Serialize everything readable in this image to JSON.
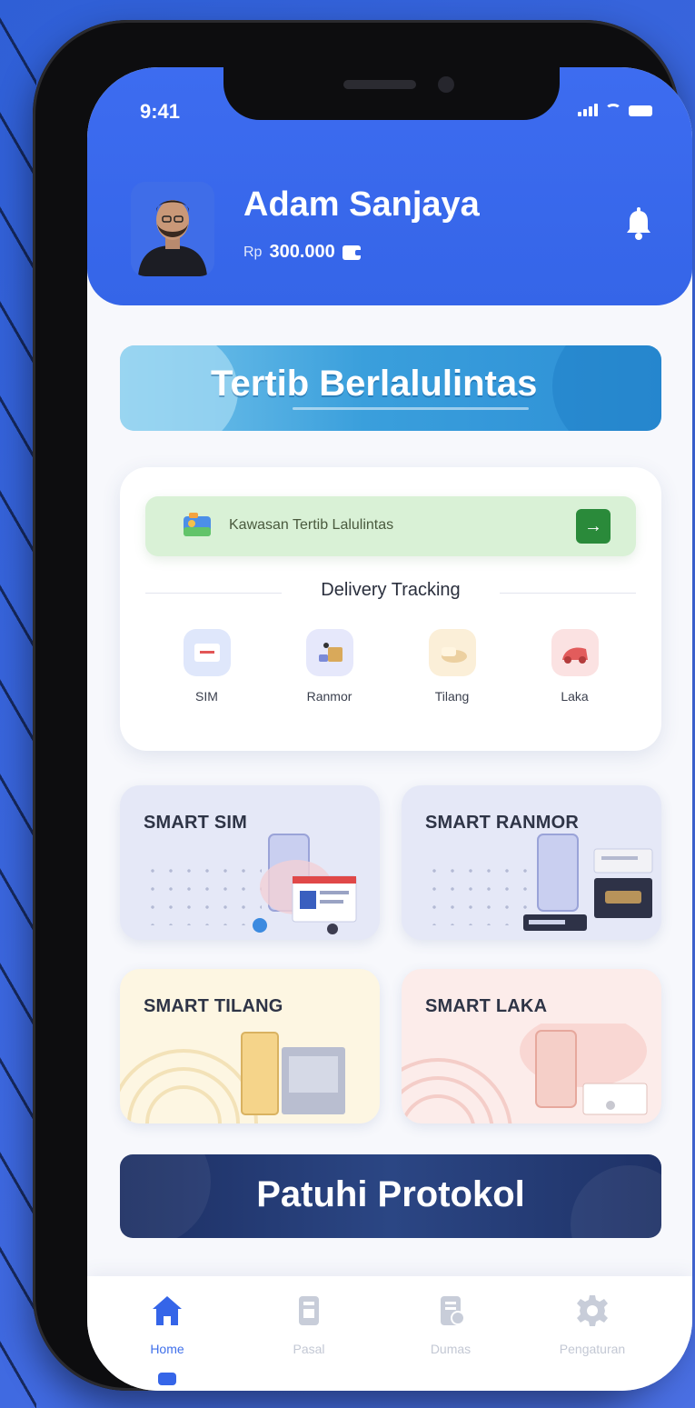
{
  "status_bar": {
    "time": "9:41"
  },
  "profile": {
    "name": "Adam Sanjaya",
    "balance_currency": "Rp",
    "balance_value": "300.000"
  },
  "banner_top": {
    "title": "Tertib Berlalulintas"
  },
  "kawasan": {
    "label": "Kawasan Tertib Lalulintas"
  },
  "delivery_tracking": {
    "title": "Delivery Tracking",
    "items": [
      {
        "label": "SIM",
        "icon": "sim-card-icon",
        "color": "#dfe7fb"
      },
      {
        "label": "Ranmor",
        "icon": "vehicle-box-icon",
        "color": "#e6e8fb"
      },
      {
        "label": "Tilang",
        "icon": "ticket-icon",
        "color": "#fbefd8"
      },
      {
        "label": "Laka",
        "icon": "accident-icon",
        "color": "#fbe2e2"
      }
    ]
  },
  "services": [
    {
      "title": "SMART SIM",
      "color": "#e5e8f7"
    },
    {
      "title": "SMART RANMOR",
      "color": "#e5e8f7"
    },
    {
      "title": "SMART TILANG",
      "color": "#fdf6e2"
    },
    {
      "title": "SMART LAKA",
      "color": "#fcecea"
    }
  ],
  "banner_bottom": {
    "title": "Patuhi Protokol"
  },
  "bottom_nav": [
    {
      "label": "Home",
      "icon": "home-icon",
      "active": true
    },
    {
      "label": "Pasal",
      "icon": "document-icon",
      "active": false
    },
    {
      "label": "Dumas",
      "icon": "report-icon",
      "active": false
    },
    {
      "label": "Pengaturan",
      "icon": "gear-icon",
      "active": false
    }
  ],
  "colors": {
    "primary": "#3565e8",
    "banner_navy": "#1f3267",
    "success": "#2a8a3a"
  }
}
